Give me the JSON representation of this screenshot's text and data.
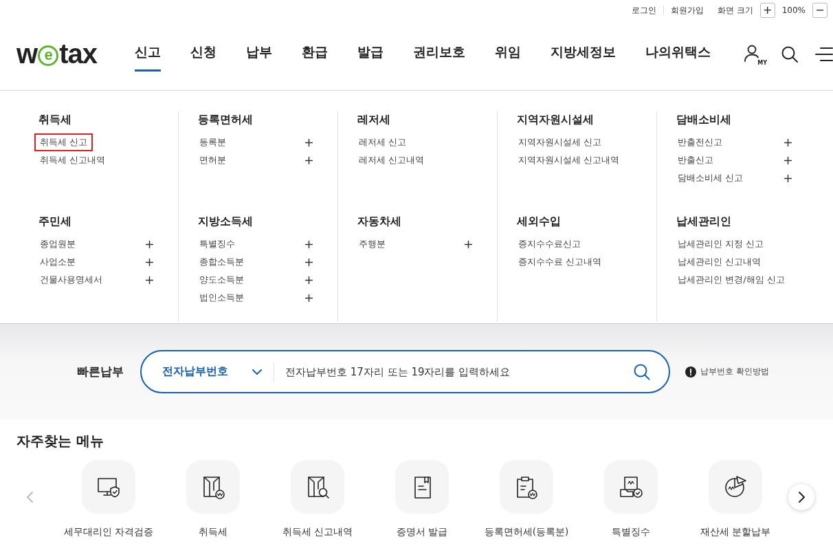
{
  "util_links": [
    "로그인",
    "회원가입"
  ],
  "zoom": {
    "label": "화면 크기",
    "plus": "+",
    "value": "100%",
    "minus": "−"
  },
  "logo": {
    "before": "w",
    "mark": "e",
    "after": "tax"
  },
  "nav": [
    {
      "label": "신고",
      "selected": true
    },
    {
      "label": "신청",
      "selected": false
    },
    {
      "label": "납부",
      "selected": false
    },
    {
      "label": "환급",
      "selected": false
    },
    {
      "label": "발급",
      "selected": false
    },
    {
      "label": "권리보호",
      "selected": false
    },
    {
      "label": "위임",
      "selected": false
    },
    {
      "label": "지방세정보",
      "selected": false
    },
    {
      "label": "나의위택스",
      "selected": false
    }
  ],
  "header_icons": {
    "my_label": "MY"
  },
  "mega_menu": [
    [
      {
        "title": "취득세",
        "items": [
          {
            "label": "취득세 신고",
            "expandable": false,
            "highlighted": true
          },
          {
            "label": "취득세 신고내역",
            "expandable": false,
            "highlighted": false
          }
        ]
      },
      {
        "title": "등록면허세",
        "items": [
          {
            "label": "등록분",
            "expandable": true,
            "highlighted": false
          },
          {
            "label": "면허분",
            "expandable": true,
            "highlighted": false
          }
        ]
      },
      {
        "title": "레저세",
        "items": [
          {
            "label": "레저세 신고",
            "expandable": false,
            "highlighted": false
          },
          {
            "label": "레저세 신고내역",
            "expandable": false,
            "highlighted": false
          }
        ]
      },
      {
        "title": "지역자원시설세",
        "items": [
          {
            "label": "지역자원시설세 신고",
            "expandable": false,
            "highlighted": false
          },
          {
            "label": "지역자원시설세 신고내역",
            "expandable": false,
            "highlighted": false
          }
        ]
      },
      {
        "title": "담배소비세",
        "items": [
          {
            "label": "반출전신고",
            "expandable": true,
            "highlighted": false
          },
          {
            "label": "반출신고",
            "expandable": true,
            "highlighted": false
          },
          {
            "label": "담배소비세 신고",
            "expandable": true,
            "highlighted": false
          }
        ]
      }
    ],
    [
      {
        "title": "주민세",
        "items": [
          {
            "label": "종업원분",
            "expandable": true,
            "highlighted": false
          },
          {
            "label": "사업소분",
            "expandable": true,
            "highlighted": false
          },
          {
            "label": "건물사용명세서",
            "expandable": true,
            "highlighted": false
          }
        ]
      },
      {
        "title": "지방소득세",
        "items": [
          {
            "label": "특별징수",
            "expandable": true,
            "highlighted": false
          },
          {
            "label": "종합소득분",
            "expandable": true,
            "highlighted": false
          },
          {
            "label": "양도소득분",
            "expandable": true,
            "highlighted": false
          },
          {
            "label": "법인소득분",
            "expandable": true,
            "highlighted": false
          }
        ]
      },
      {
        "title": "자동차세",
        "items": [
          {
            "label": "주행분",
            "expandable": true,
            "highlighted": false
          }
        ]
      },
      {
        "title": "세외수입",
        "items": [
          {
            "label": "증지수수료신고",
            "expandable": false,
            "highlighted": false
          },
          {
            "label": "증지수수료 신고내역",
            "expandable": false,
            "highlighted": false
          }
        ]
      },
      {
        "title": "납세관리인",
        "items": [
          {
            "label": "납세관리인 지정 신고",
            "expandable": false,
            "highlighted": false
          },
          {
            "label": "납세관리인 신고내역",
            "expandable": false,
            "highlighted": false
          },
          {
            "label": "납세관리인 변경/해임 신고",
            "expandable": false,
            "highlighted": false
          }
        ]
      }
    ]
  ],
  "quick_pay": {
    "label": "빠른납부",
    "select_value": "전자납부번호",
    "placeholder": "전자납부번호 17자리 또는 19자리를 입력하세요",
    "help": "납부번호 확인방법"
  },
  "frequent_menu": {
    "title": "자주찾는 메뉴",
    "items": [
      {
        "label": "세무대리인 자격검증",
        "kind": "monitor"
      },
      {
        "label": "취득세",
        "kind": "docwon"
      },
      {
        "label": "취득세 신고내역",
        "kind": "docsearch"
      },
      {
        "label": "증명서 발급",
        "kind": "bookmark"
      },
      {
        "label": "등록면허세(등록분)",
        "kind": "clipboard"
      },
      {
        "label": "특별징수",
        "kind": "tray"
      },
      {
        "label": "재산세 분할납부",
        "kind": "pie"
      }
    ]
  }
}
